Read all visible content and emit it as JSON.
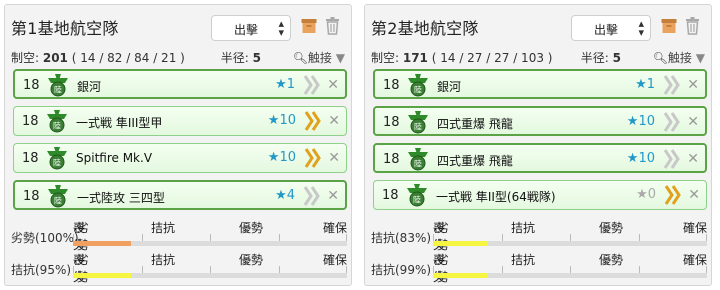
{
  "sortie_label": "出擊",
  "icon_label": "陸",
  "scale_labels": [
    "喪失",
    "劣勢",
    "拮抗",
    "優勢",
    "確保"
  ],
  "colors": {
    "slot_border": "#5ba347",
    "star": "#2298c8",
    "proficiency": "#e0a21c",
    "gauge_orange": "#f0a060",
    "gauge_yellow": "#f5f542"
  },
  "bases": [
    {
      "title": "第1基地航空隊",
      "air_label": "制空: ",
      "air_value": "201",
      "air_detail": " ( 14 / 82 / 84 / 21 )",
      "range_label": "半径: ",
      "range_value": "5",
      "contact_label": "触接",
      "slots": [
        {
          "count": "18",
          "name": "銀河",
          "star": "★1",
          "proficiency": "grey",
          "border": "thick"
        },
        {
          "count": "18",
          "name": "一式戦 隼III型甲",
          "star": "★10",
          "proficiency": "gold",
          "border": "thin"
        },
        {
          "count": "18",
          "name": "Spitfire Mk.V",
          "star": "★10",
          "proficiency": "gold",
          "border": "thin"
        },
        {
          "count": "18",
          "name": "一式陸攻 三四型",
          "star": "★4",
          "proficiency": "grey",
          "border": "thick"
        }
      ],
      "waves": [
        {
          "state": "劣勢(100%)",
          "fill": 0.21,
          "color": "#f0a060"
        },
        {
          "state": "拮抗(95%)",
          "fill": 0.21,
          "color": "#f5f542"
        }
      ]
    },
    {
      "title": "第2基地航空隊",
      "air_label": "制空: ",
      "air_value": "171",
      "air_detail": " ( 14 / 27 / 27 / 103 )",
      "range_label": "半径: ",
      "range_value": "5",
      "contact_label": "触接",
      "slots": [
        {
          "count": "18",
          "name": "銀河",
          "star": "★1",
          "proficiency": "grey",
          "border": "thick"
        },
        {
          "count": "18",
          "name": "四式重爆 飛龍",
          "star": "★10",
          "proficiency": "grey",
          "border": "thick"
        },
        {
          "count": "18",
          "name": "四式重爆 飛龍",
          "star": "★10",
          "proficiency": "grey",
          "border": "thick"
        },
        {
          "count": "18",
          "name": "一式戦 隼II型(64戦隊)",
          "star": "★0",
          "proficiency": "gold",
          "border": "thin"
        }
      ],
      "waves": [
        {
          "state": "拮抗(83%)",
          "fill": 0.2,
          "color": "#f5f542"
        },
        {
          "state": "拮抗(99%)",
          "fill": 0.2,
          "color": "#f5f542"
        }
      ]
    }
  ]
}
